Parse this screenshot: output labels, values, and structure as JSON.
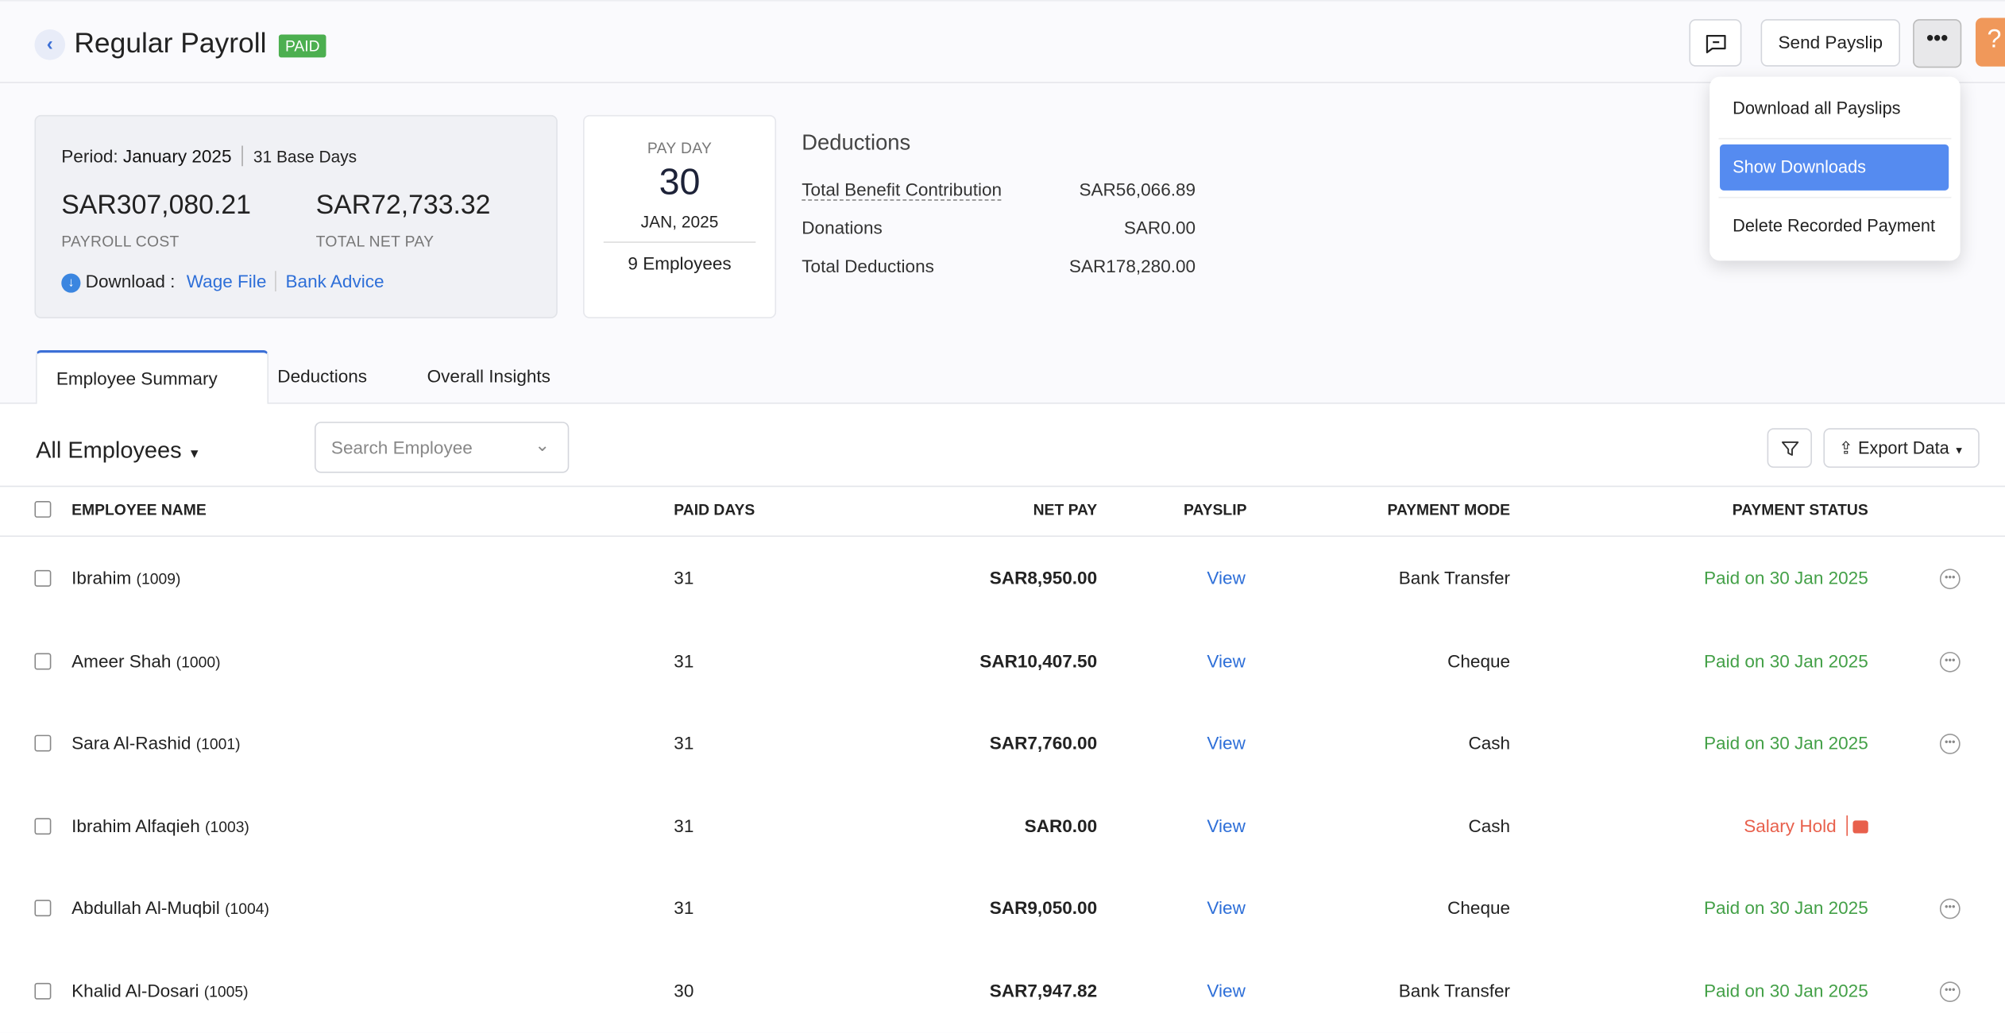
{
  "header": {
    "title": "Regular Payroll",
    "status_badge": "PAID",
    "send_payslip": "Send Payslip",
    "help": "?"
  },
  "summary": {
    "period_label": "Period:",
    "period": "January 2025",
    "base_days": "31 Base Days",
    "payroll_cost": "SAR307,080.21",
    "payroll_cost_label": "PAYROLL COST",
    "total_net_pay": "SAR72,733.32",
    "total_net_pay_label": "TOTAL NET PAY",
    "download_label": "Download :",
    "wage_file": "Wage File",
    "bank_advice": "Bank Advice"
  },
  "payday": {
    "label": "PAY DAY",
    "day": "30",
    "month_year": "JAN, 2025",
    "employees": "9 Employees"
  },
  "deductions": {
    "title": "Deductions",
    "rows": [
      {
        "label": "Total Benefit Contribution",
        "value": "SAR56,066.89"
      },
      {
        "label": "Donations",
        "value": "SAR0.00"
      },
      {
        "label": "Total Deductions",
        "value": "SAR178,280.00"
      }
    ]
  },
  "menu": {
    "items": [
      "Download all Payslips",
      "Show Downloads",
      "Delete Recorded Payment"
    ],
    "highlighted": "Show Downloads"
  },
  "tabs": [
    "Employee Summary",
    "Deductions",
    "Overall Insights"
  ],
  "filter": {
    "view": "All Employees",
    "search_placeholder": "Search Employee",
    "export": "Export Data"
  },
  "table": {
    "columns": [
      "EMPLOYEE NAME",
      "PAID DAYS",
      "NET PAY",
      "PAYSLIP",
      "PAYMENT MODE",
      "PAYMENT STATUS"
    ],
    "rows": [
      {
        "name": "Ibrahim",
        "id": "(1009)",
        "paid_days": "31",
        "net_pay": "SAR8,950.00",
        "payslip": "View",
        "mode": "Bank Transfer",
        "status": "Paid on 30 Jan 2025",
        "status_type": "paid"
      },
      {
        "name": "Ameer Shah",
        "id": "(1000)",
        "paid_days": "31",
        "net_pay": "SAR10,407.50",
        "payslip": "View",
        "mode": "Cheque",
        "status": "Paid on 30 Jan 2025",
        "status_type": "paid"
      },
      {
        "name": "Sara Al-Rashid",
        "id": "(1001)",
        "paid_days": "31",
        "net_pay": "SAR7,760.00",
        "payslip": "View",
        "mode": "Cash",
        "status": "Paid on 30 Jan 2025",
        "status_type": "paid"
      },
      {
        "name": "Ibrahim Alfaqieh",
        "id": "(1003)",
        "paid_days": "31",
        "net_pay": "SAR0.00",
        "payslip": "View",
        "mode": "Cash",
        "status": "Salary Hold",
        "status_type": "hold"
      },
      {
        "name": "Abdullah Al-Muqbil",
        "id": "(1004)",
        "paid_days": "31",
        "net_pay": "SAR9,050.00",
        "payslip": "View",
        "mode": "Cheque",
        "status": "Paid on 30 Jan 2025",
        "status_type": "paid"
      },
      {
        "name": "Khalid Al-Dosari",
        "id": "(1005)",
        "paid_days": "30",
        "net_pay": "SAR7,947.82",
        "payslip": "View",
        "mode": "Bank Transfer",
        "status": "Paid on 30 Jan 2025",
        "status_type": "paid"
      }
    ]
  },
  "colors": {
    "paid": "#43a047",
    "hold": "#e8604c",
    "link": "#2e6fd8",
    "accent": "#558bf0",
    "help": "#f0985a"
  }
}
